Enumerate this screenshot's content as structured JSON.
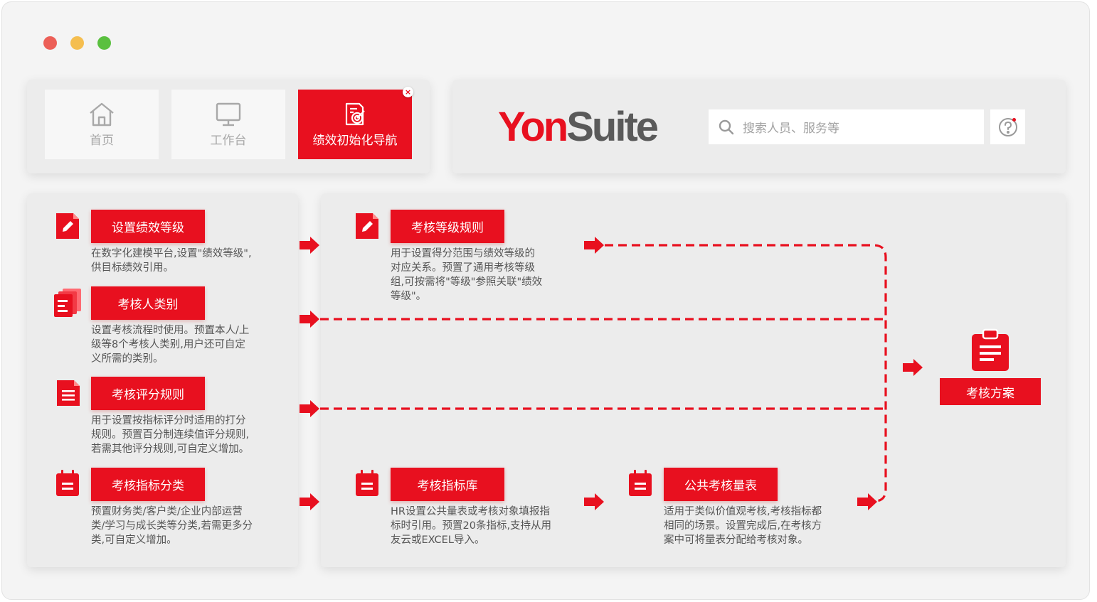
{
  "window": {
    "controls": [
      "close",
      "minimize",
      "maximize"
    ]
  },
  "tabs": [
    {
      "label": "首页",
      "icon": "home-icon"
    },
    {
      "label": "工作台",
      "icon": "monitor-icon"
    },
    {
      "label": "绩效初始化导航",
      "icon": "target-doc-icon",
      "active": true,
      "close": "×"
    }
  ],
  "header": {
    "logo_part1": "Yon",
    "logo_part2": "Suite",
    "search_placeholder": "搜索人员、服务等",
    "help_icon": "help-icon"
  },
  "colors": {
    "accent": "#e8101f",
    "logo_gray": "#5a5a5a",
    "background": "#f4f4f4"
  },
  "left_steps": [
    {
      "label": "设置绩效等级",
      "icon": "edit-doc-icon",
      "desc": [
        "在数字化建模平台,设置\"绩效等级\",",
        "供目标绩效引用。"
      ]
    },
    {
      "label": "考核人类别",
      "icon": "documents-icon",
      "desc": [
        "设置考核流程时使用。预置本人/上",
        "级等8个考核人类别,用户还可自定",
        "义所需的类别。"
      ]
    },
    {
      "label": "考核评分规则",
      "icon": "document-icon",
      "desc": [
        "用于设置按指标评分时适用的打分",
        "规则。预置百分制连续值评分规则,",
        "若需其他评分规则,可自定义增加。"
      ]
    },
    {
      "label": "考核指标分类",
      "icon": "calendar-icon",
      "desc": [
        "预置财务类/客户类/企业内部运营",
        "类/学习与成长类等分类,若需更多分",
        "类,可自定义增加。"
      ]
    }
  ],
  "middle_steps": [
    {
      "label": "考核等级规则",
      "icon": "edit-doc-icon",
      "desc": [
        "用于设置得分范围与绩效等级的",
        "对应关系。预置了通用考核等级",
        "组,可按需将\"等级\"参照关联\"绩效",
        "等级\"。"
      ]
    },
    {
      "label": "考核指标库",
      "icon": "calendar-icon",
      "desc": [
        "HR设置公共量表或考核对象填报指",
        "标时引用。预置20条指标,支持从用",
        "友云或EXCEL导入。"
      ]
    },
    {
      "label": "公共考核量表",
      "icon": "calendar-icon",
      "desc": [
        "适用于类似价值观考核,考核指标都",
        "相同的场景。设置完成后,在考核方",
        "案中可将量表分配给考核对象。"
      ]
    }
  ],
  "result": {
    "label": "考核方案",
    "icon": "clipboard-icon"
  }
}
